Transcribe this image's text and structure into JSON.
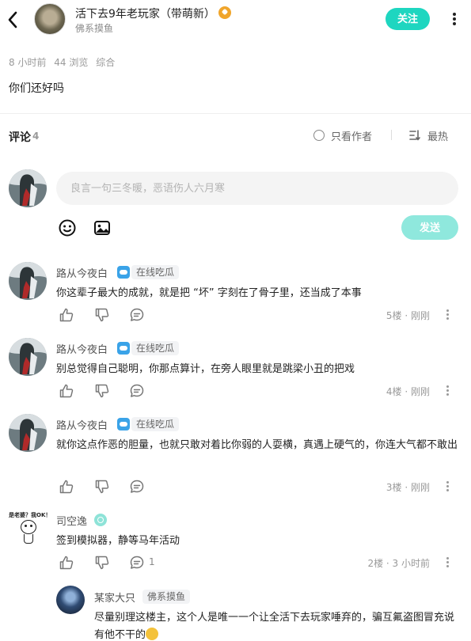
{
  "header": {
    "author_name": "活下去9年老玩家（带萌新）",
    "author_subtitle": "佛系摸鱼",
    "follow_label": "关注"
  },
  "post": {
    "time_ago": "8 小时前",
    "views": "44 浏览",
    "category": "综合",
    "body": "你们还好吗"
  },
  "comments_header": {
    "title": "评论",
    "count": "4",
    "only_author_label": "只看作者",
    "sort_label": "最热"
  },
  "composer": {
    "placeholder": "良言一句三冬暖，恶语伤人六月寒",
    "send_label": "发送"
  },
  "comments": [
    {
      "name": "路从今夜白",
      "tag": "在线吃瓜",
      "text": "你这辈子最大的成就，就是把 “坏” 字刻在了骨子里，还当成了本事",
      "floor": "5楼 · 刚刚"
    },
    {
      "name": "路从今夜白",
      "tag": "在线吃瓜",
      "text": "别总觉得自己聪明，你那点算计，在旁人眼里就是跳梁小丑的把戏",
      "floor": "4楼 · 刚刚"
    },
    {
      "name": "路从今夜白",
      "tag": "在线吃瓜",
      "text": "就你这点作恶的胆量，也就只敢对着比你弱的人耍横，真遇上硬气的，你连大气都不敢出",
      "floor": "3楼 · 刚刚"
    },
    {
      "name": "司空逸",
      "meme_caption": "是老婆？我OK！",
      "text": "签到模拟器，静等马年活动",
      "reply_count": "1",
      "floor": "2楼 · 3 小时前"
    }
  ],
  "reply": {
    "name": "某家大只",
    "tag": "佛系摸鱼",
    "text": "尽量别理这楼主，这个人是唯一一个让全活下去玩家唾弃的，骗互氟盗图冒充说有他不干的"
  }
}
